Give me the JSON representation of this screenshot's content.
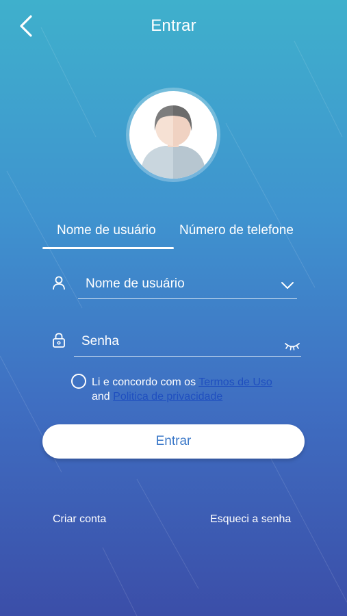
{
  "header": {
    "title": "Entrar",
    "back_icon": "chevron-left-icon"
  },
  "avatar": {
    "icon": "user-avatar-icon"
  },
  "tabs": [
    {
      "label": "Nome de usuário",
      "selected": true
    },
    {
      "label": "Número de telefone",
      "selected": false
    }
  ],
  "username_field": {
    "icon": "user-icon",
    "value": "",
    "placeholder": "Nome de usuário",
    "dropdown_icon": "chevron-down-icon"
  },
  "password_field": {
    "icon": "lock-icon",
    "value": "",
    "placeholder": "Senha",
    "visibility_icon": "eye-closed-icon"
  },
  "agreement": {
    "checked": false,
    "text_before": "Li e concordo com os ",
    "terms_label": "Termos de Uso",
    "text_middle": "and ",
    "privacy_label": "Politica de privacidade"
  },
  "submit_label": "Entrar",
  "footer": {
    "create_account": "Criar conta",
    "forgot_password": "Esqueci a senha"
  },
  "colors": {
    "gradient_top": "#3fb0cc",
    "gradient_bottom": "#3b4ea8",
    "link": "#1f4fbf",
    "button_text": "#3b78c8"
  }
}
